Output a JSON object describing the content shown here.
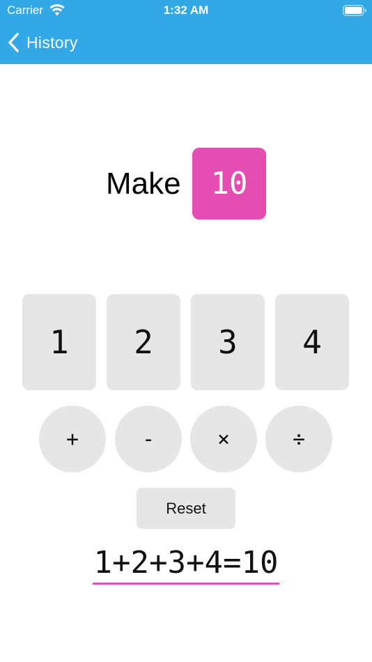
{
  "status_bar": {
    "carrier": "Carrier",
    "time": "1:32 AM",
    "wifi_icon": "wifi-icon",
    "battery_icon": "battery-icon"
  },
  "nav": {
    "back_label": "History",
    "back_icon": "chevron-left-icon",
    "bar_color": "#33a8e6"
  },
  "target": {
    "prefix": "Make",
    "value": "10",
    "accent_color": "#e64db3"
  },
  "cards": [
    {
      "label": "1"
    },
    {
      "label": "2"
    },
    {
      "label": "3"
    },
    {
      "label": "4"
    }
  ],
  "operators": [
    {
      "label": "+"
    },
    {
      "label": "-"
    },
    {
      "label": "×"
    },
    {
      "label": "÷"
    }
  ],
  "reset_label": "Reset",
  "equation": "1+2+3+4=10"
}
